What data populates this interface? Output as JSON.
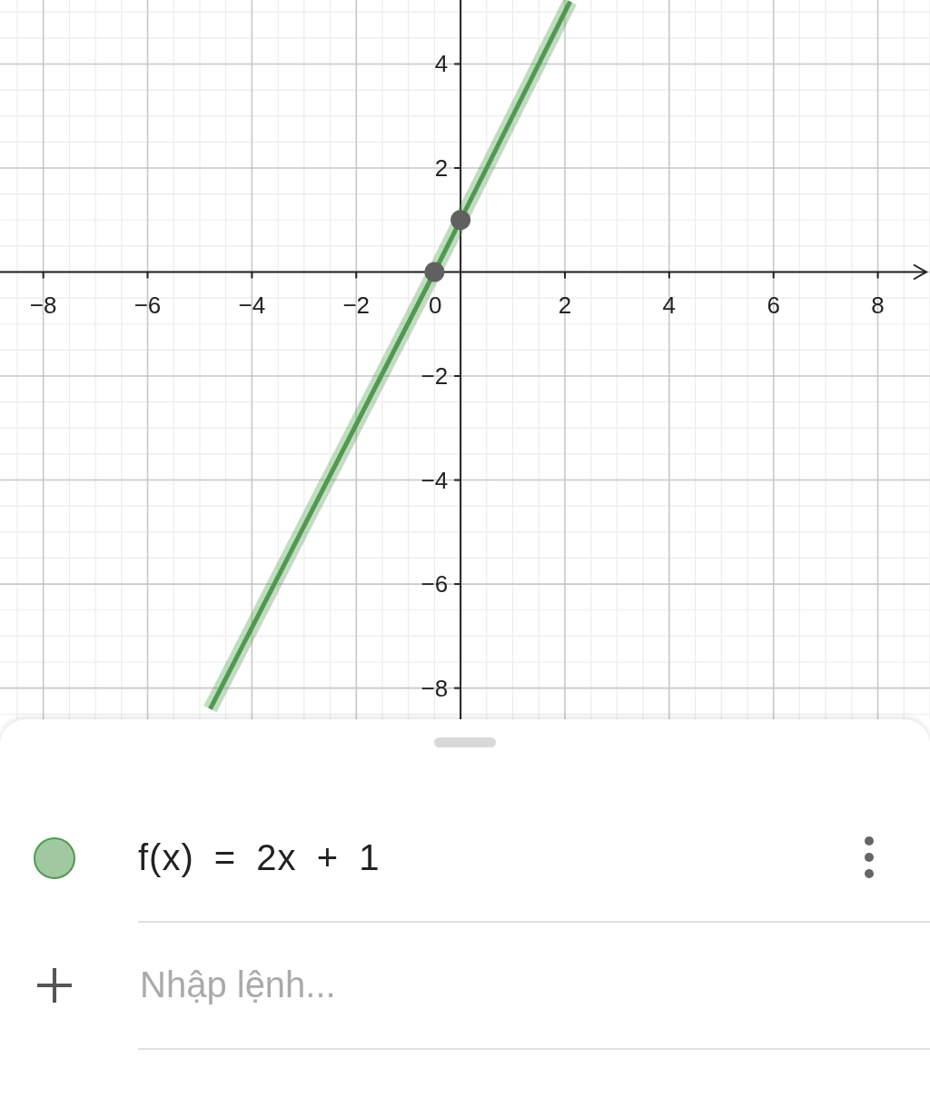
{
  "graph": {
    "chart_data": {
      "type": "line",
      "x": [
        -4.8,
        -0.5,
        0,
        2.1
      ],
      "series": [
        {
          "color": "#4f9a4f",
          "values": [
            -8.4,
            0,
            1,
            5.2
          ]
        }
      ],
      "grid": true,
      "xlim": [
        -8.83,
        9.0
      ],
      "ylim": [
        -8.6,
        5.23
      ],
      "xticks": [
        {
          "value": -8,
          "label": "−8"
        },
        {
          "value": -6,
          "label": "−6"
        },
        {
          "value": -4,
          "label": "−4"
        },
        {
          "value": -2,
          "label": "−2"
        },
        {
          "value": 2,
          "label": "2"
        },
        {
          "value": 4,
          "label": "4"
        },
        {
          "value": 6,
          "label": "6"
        },
        {
          "value": 8,
          "label": "8"
        }
      ],
      "yticks": [
        {
          "value": -8,
          "label": "−8"
        },
        {
          "value": -6,
          "label": "−6"
        },
        {
          "value": -4,
          "label": "−4"
        },
        {
          "value": -2,
          "label": "−2"
        },
        {
          "value": 2,
          "label": "2"
        },
        {
          "value": 4,
          "label": "4"
        }
      ]
    },
    "origin_label": "0"
  },
  "algebra": {
    "items": [
      {
        "expression": "f(x) = 2x + 1",
        "visible": true,
        "color": "#4f9a4f"
      }
    ],
    "input": {
      "placeholder": "Nhập lệnh..."
    }
  }
}
